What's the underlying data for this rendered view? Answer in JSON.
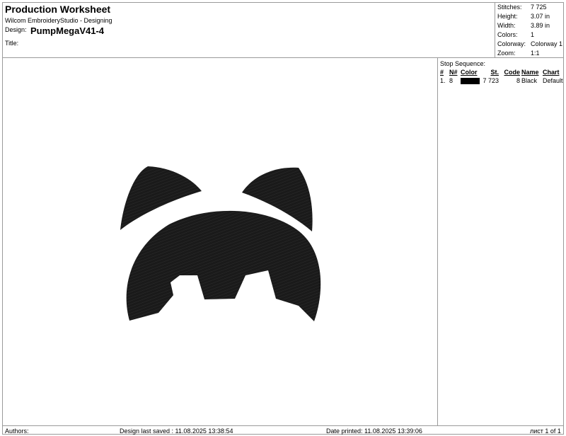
{
  "header": {
    "title": "Production Worksheet",
    "software": "Wilcom EmbroideryStudio - Designing",
    "design_label": "Design:",
    "design_value": "PumpMegaV41-4",
    "title_label": "Title:"
  },
  "specs": [
    {
      "label": "Stitches:",
      "value": "7 725"
    },
    {
      "label": "Height:",
      "value": "3.07 in"
    },
    {
      "label": "Width:",
      "value": "3.89 in"
    },
    {
      "label": "Colors:",
      "value": "1"
    },
    {
      "label": "Colorway:",
      "value": "Colorway 1"
    },
    {
      "label": "Zoom:",
      "value": "1:1"
    }
  ],
  "stop_sequence": {
    "title": "Stop Sequence:",
    "headers": {
      "num": "#",
      "n": "N#",
      "color": "Color",
      "st": "St.",
      "code": "Code",
      "name": "Name",
      "chart": "Chart"
    },
    "rows": [
      {
        "num": "1.",
        "n": "8",
        "color_hex": "#000000",
        "st": "7 723",
        "code": "8",
        "name": "Black",
        "chart": "Default"
      }
    ]
  },
  "design_color": "#1a1a1a",
  "footer": {
    "authors": "Authors:",
    "last_saved": "Design last saved : 11.08.2025 13:38:54",
    "printed": "Date printed: 11.08.2025 13:39:06",
    "page": "лист 1 of 1"
  }
}
